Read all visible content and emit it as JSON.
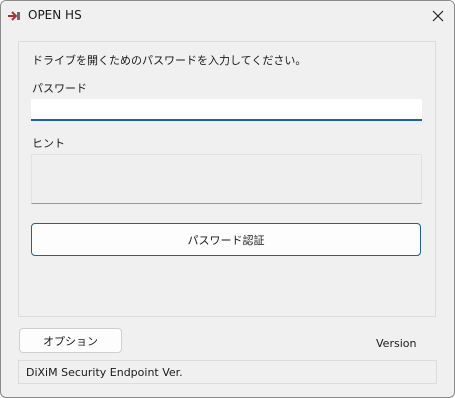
{
  "window": {
    "title": "OPEN HS",
    "icon": "app-icon",
    "close_icon": "close-icon"
  },
  "form": {
    "instruction": "ドライブを開くためのパスワードを入力してください。",
    "password_label": "パスワード",
    "password_value": "",
    "hint_label": "ヒント",
    "hint_value": "",
    "auth_button": "パスワード認証"
  },
  "footer": {
    "option_button": "オプション",
    "version_label": "Version",
    "status_text": "DiXiM Security Endpoint Ver."
  },
  "colors": {
    "accent": "#1d5fa8",
    "window_bg": "#f0f0f0"
  }
}
